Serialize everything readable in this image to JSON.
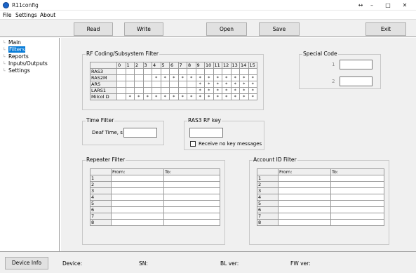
{
  "window": {
    "title": "R11config",
    "controls": [
      "↔",
      "–",
      "□",
      "✕"
    ]
  },
  "menu": [
    "File",
    "Settings",
    "About"
  ],
  "toolbar": {
    "read": "Read",
    "write": "Write",
    "open": "Open",
    "save": "Save",
    "exit": "Exit"
  },
  "tree": {
    "items": [
      "Main",
      "Filters",
      "Reports",
      "Inputs/Outputs",
      "Settings"
    ],
    "selected": "Filters"
  },
  "rf_filter": {
    "title": "RF Coding/Subsystem Filter",
    "columns": [
      "0",
      "1",
      "2",
      "3",
      "4",
      "5",
      "6",
      "7",
      "8",
      "9",
      "10",
      "11",
      "12",
      "13",
      "14",
      "15"
    ],
    "rows": [
      {
        "name": "RAS3",
        "cells": [
          "",
          "",
          "",
          "",
          "",
          "",
          "",
          "",
          "",
          "",
          "",
          "",
          "",
          "",
          "",
          ""
        ]
      },
      {
        "name": "RAS2M",
        "cells": [
          "",
          "",
          "",
          "",
          "*",
          "*",
          "*",
          "*",
          "*",
          "*",
          "*",
          "*",
          "*",
          "*",
          "*",
          "*"
        ]
      },
      {
        "name": "ARS",
        "cells": [
          "",
          "",
          "",
          "",
          "",
          "",
          "",
          "",
          "",
          "*",
          "*",
          "*",
          "*",
          "*",
          "*",
          "*"
        ]
      },
      {
        "name": "LARS1",
        "cells": [
          "",
          "",
          "",
          "",
          "",
          "",
          "",
          "",
          "",
          "*",
          "*",
          "*",
          "*",
          "*",
          "*",
          "*"
        ]
      },
      {
        "name": "Milcol D",
        "cells": [
          "",
          "*",
          "*",
          "*",
          "*",
          "*",
          "*",
          "*",
          "*",
          "*",
          "*",
          "*",
          "*",
          "*",
          "*",
          "*"
        ]
      }
    ]
  },
  "special_code": {
    "title": "Special Code",
    "label1": "1",
    "label2": "2",
    "value1": "",
    "value2": ""
  },
  "time_filter": {
    "title": "Time Filter",
    "label": "Deaf Time, s",
    "value": ""
  },
  "rf_key": {
    "title": "RAS3 RF key",
    "value": "",
    "checkbox_label": "Receive no key messages"
  },
  "repeater_filter": {
    "title": "Repeater Filter",
    "col_from": "From:",
    "col_to": "To:",
    "rows": [
      "1",
      "2",
      "3",
      "4",
      "5",
      "6",
      "7",
      "8"
    ]
  },
  "account_filter": {
    "title": "Account ID Filter",
    "col_from": "From:",
    "col_to": "To:",
    "rows": [
      "1",
      "2",
      "3",
      "4",
      "5",
      "6",
      "7",
      "8"
    ]
  },
  "status": {
    "device_info": "Device Info",
    "device": "Device:",
    "sn": "SN:",
    "bl": "BL ver:",
    "fw": "FW ver:"
  }
}
